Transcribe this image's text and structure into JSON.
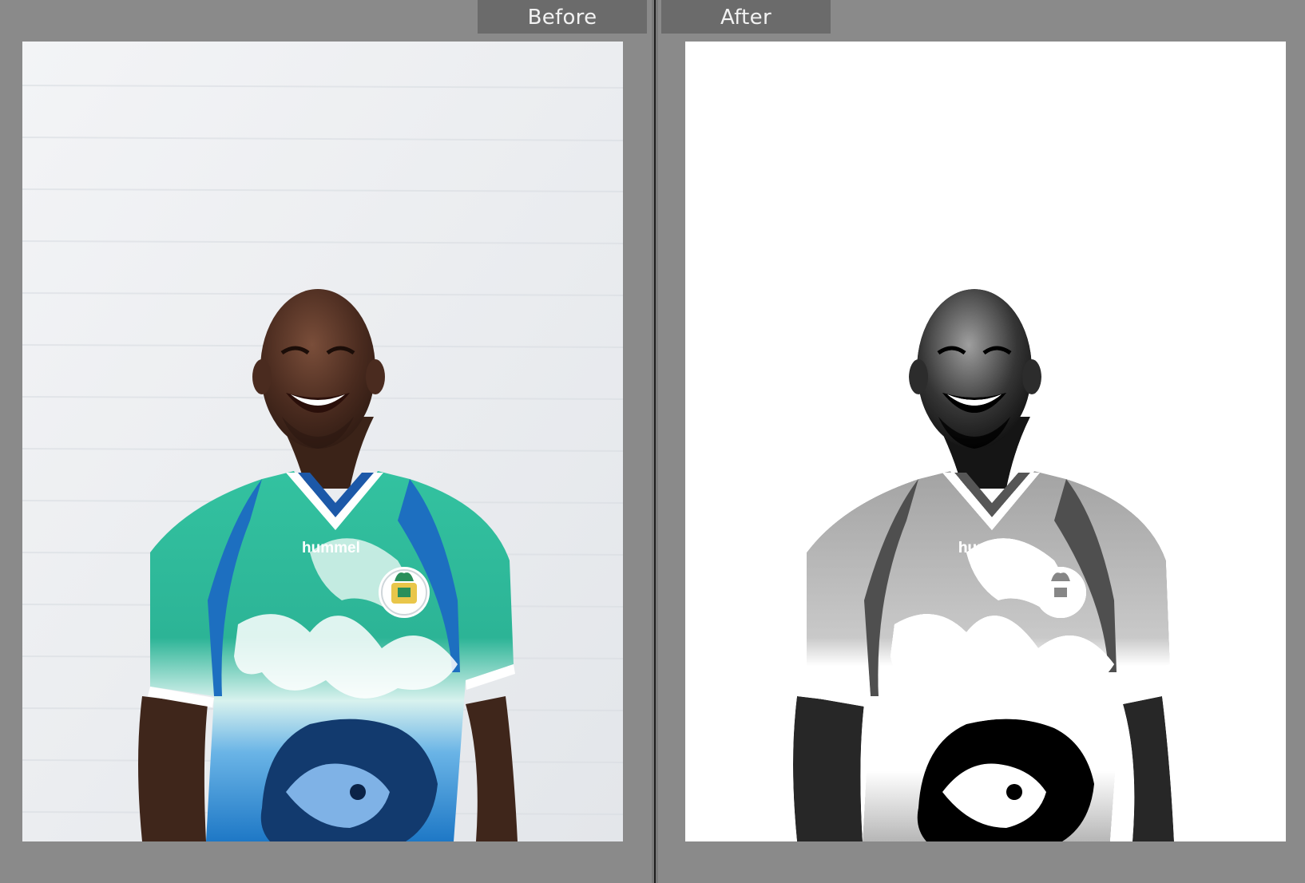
{
  "compare": {
    "before_label": "Before",
    "after_label": "After"
  },
  "shirt": {
    "brand": "hummel"
  },
  "colors": {
    "background": "#8a8a8a",
    "label_bg": "#6b6b6b",
    "label_text": "#f2f2f2",
    "wall": "#eef0f2",
    "jersey_green": "#2fb497",
    "jersey_blue": "#1f79c8",
    "skin": "#4a2d22"
  },
  "icons": {
    "crest": "sierra-leone-crest-icon"
  }
}
